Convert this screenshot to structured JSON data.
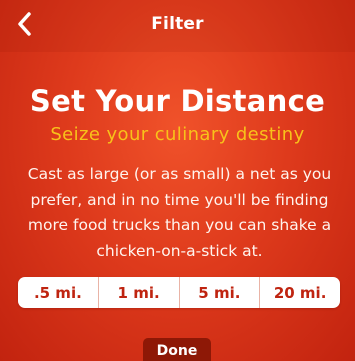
{
  "nav": {
    "title": "Filter",
    "back_icon": "chevron-left-icon"
  },
  "content": {
    "heading": "Set Your Distance",
    "tagline": "Seize your culinary destiny",
    "description": "Cast as large (or as small) a net as you prefer, and in no time you'll be finding more food trucks than you can shake a chicken-on-a-stick at."
  },
  "distance_options": [
    ".5 mi.",
    "1 mi.",
    "5 mi.",
    "20 mi."
  ],
  "done_label": "Done",
  "colors": {
    "background": "#de3a1c",
    "accent_yellow": "#f8c21a",
    "segment_text": "#bf2410",
    "done_button": "#8e1806"
  }
}
